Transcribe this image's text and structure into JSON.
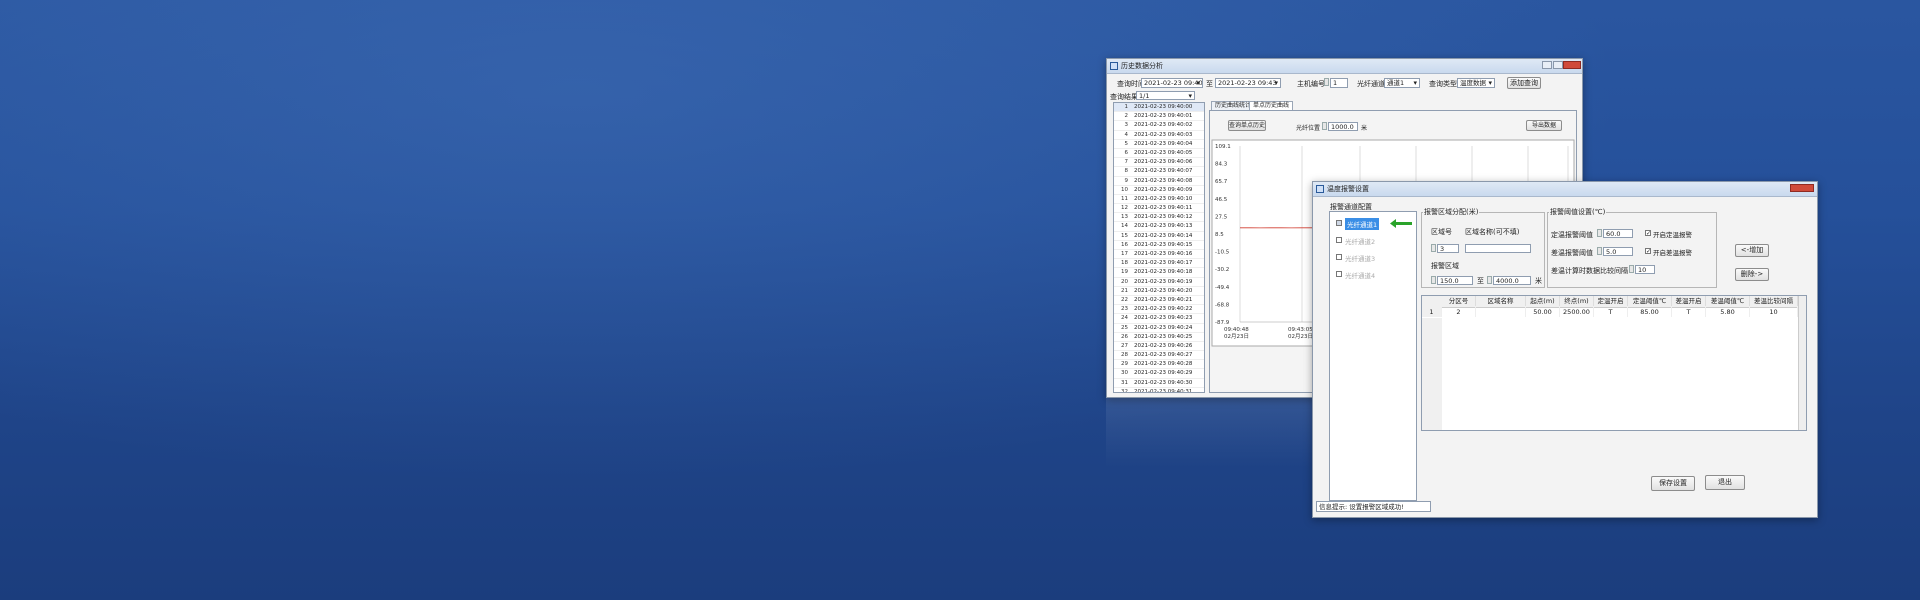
{
  "win1": {
    "title": "历史数据分析",
    "query_time_label": "查询时间",
    "start_time": "2021-02-23 09:40",
    "to_label": "至",
    "end_time": "2021-02-23 09:43",
    "host_label": "主机编号",
    "host_value": "1",
    "channel_label": "光纤通道",
    "channel_value": "通道1",
    "query_type_label": "查询类型",
    "query_type_value": "温度数据",
    "add_button": "添加查询",
    "result_label": "查询结果",
    "result_value": "1/1",
    "rows": [
      {
        "n": "1",
        "t": "2021-02-23 09:40:00"
      },
      {
        "n": "2",
        "t": "2021-02-23 09:40:01"
      },
      {
        "n": "3",
        "t": "2021-02-23 09:40:02"
      },
      {
        "n": "4",
        "t": "2021-02-23 09:40:03"
      },
      {
        "n": "5",
        "t": "2021-02-23 09:40:04"
      },
      {
        "n": "6",
        "t": "2021-02-23 09:40:05"
      },
      {
        "n": "7",
        "t": "2021-02-23 09:40:06"
      },
      {
        "n": "8",
        "t": "2021-02-23 09:40:07"
      },
      {
        "n": "9",
        "t": "2021-02-23 09:40:08"
      },
      {
        "n": "10",
        "t": "2021-02-23 09:40:09"
      },
      {
        "n": "11",
        "t": "2021-02-23 09:40:10"
      },
      {
        "n": "12",
        "t": "2021-02-23 09:40:11"
      },
      {
        "n": "13",
        "t": "2021-02-23 09:40:12"
      },
      {
        "n": "14",
        "t": "2021-02-23 09:40:13"
      },
      {
        "n": "15",
        "t": "2021-02-23 09:40:14"
      },
      {
        "n": "16",
        "t": "2021-02-23 09:40:15"
      },
      {
        "n": "17",
        "t": "2021-02-23 09:40:16"
      },
      {
        "n": "18",
        "t": "2021-02-23 09:40:17"
      },
      {
        "n": "19",
        "t": "2021-02-23 09:40:18"
      },
      {
        "n": "20",
        "t": "2021-02-23 09:40:19"
      },
      {
        "n": "21",
        "t": "2021-02-23 09:40:20"
      },
      {
        "n": "22",
        "t": "2021-02-23 09:40:21"
      },
      {
        "n": "23",
        "t": "2021-02-23 09:40:22"
      },
      {
        "n": "24",
        "t": "2021-02-23 09:40:23"
      },
      {
        "n": "25",
        "t": "2021-02-23 09:40:24"
      },
      {
        "n": "26",
        "t": "2021-02-23 09:40:25"
      },
      {
        "n": "27",
        "t": "2021-02-23 09:40:26"
      },
      {
        "n": "28",
        "t": "2021-02-23 09:40:27"
      },
      {
        "n": "29",
        "t": "2021-02-23 09:40:28"
      },
      {
        "n": "30",
        "t": "2021-02-23 09:40:29"
      },
      {
        "n": "31",
        "t": "2021-02-23 09:40:30"
      },
      {
        "n": "32",
        "t": "2021-02-23 09:40:31"
      }
    ],
    "tab1": "历史曲线统计",
    "tab2": "单点历史曲线",
    "point_button": "查询单点历史",
    "position_label": "光纤位置",
    "position_value": "1000.0",
    "position_unit": "米",
    "export_button": "导出数据",
    "x_tick_1": "09:40:48",
    "x_tick_1b": "02月23日",
    "x_tick_2": "09:43:05",
    "x_tick_2b": "02月23日"
  },
  "chart_data": {
    "type": "line",
    "title": "",
    "xlabel": "",
    "ylabel": "",
    "y_ticks": [
      "109.1",
      "84.3",
      "65.7",
      "46.5",
      "27.5",
      "8.5",
      "-10.5",
      "-30.2",
      "-49.4",
      "-68.8",
      "-87.9"
    ],
    "ylim": [
      -87.9,
      109.1
    ],
    "series": [
      {
        "values": [
          17.5,
          17.5,
          17.4,
          17.5,
          17.5,
          17.4,
          17.5,
          17.5
        ]
      }
    ],
    "line_color": "#d03a2e",
    "grid": true
  },
  "win2": {
    "title": "温度报警设置",
    "channel_group": "报警通道配置",
    "channels": [
      "光纤通道1",
      "光纤通道2",
      "光纤通道3",
      "光纤通道4"
    ],
    "zone_group": "报警区域分配(米)",
    "zone_no_label": "区域号",
    "zone_name_label": "区域名称(可不填)",
    "zone_no_value": "3",
    "zone_name_value": "",
    "zone_range_label": "报警区域",
    "zone_from": "150.0",
    "zone_to_label": "至",
    "zone_to": "4000.0",
    "zone_unit": "米",
    "threshold_group": "报警阈值设置(℃)",
    "fixed_label": "定温报警阈值",
    "fixed_value": "60.0",
    "fixed_enable": "开启定温报警",
    "diff_label": "差温报警阈值",
    "diff_value": "5.0",
    "diff_enable": "开启差温报警",
    "diff_interval_label": "差温计算时数据比较间隔",
    "diff_interval_value": "10",
    "add_button": "<-增加",
    "delete_button": "删除->",
    "table_headers": [
      "分区号",
      "区域名称",
      "起点(m)",
      "终点(m)",
      "定温开启",
      "定温阈值℃",
      "差温开启",
      "差温阈值℃",
      "差温比较间隔"
    ],
    "table_row": {
      "idx": "1",
      "cells": [
        "2",
        "",
        "50.00",
        "2500.00",
        "T",
        "85.00",
        "T",
        "5.80",
        "10"
      ]
    },
    "save_button": "保存设置",
    "exit_button": "退出",
    "status_text": "信息提示: 设置报警区域成功!"
  },
  "colors": {
    "accent_selected": "#3a8ee6",
    "arrow": "#2aa32a",
    "background": "#25509a"
  }
}
